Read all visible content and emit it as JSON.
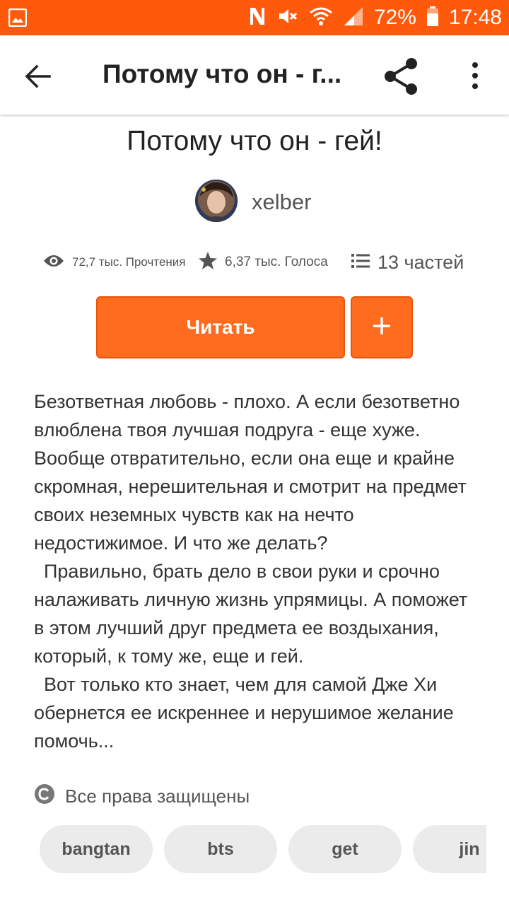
{
  "status_bar": {
    "battery": "72%",
    "time": "17:48",
    "icons": [
      "gallery-icon",
      "n-icon",
      "mute-icon",
      "wifi-icon",
      "signal-icon",
      "battery-icon"
    ]
  },
  "app_bar": {
    "title": "Потому что он - г...",
    "icons": [
      "back-arrow-icon",
      "share-icon",
      "more-vert-icon"
    ]
  },
  "story": {
    "title": "Потому что он - гей!",
    "author": "xelber",
    "stats": {
      "reads": "72,7 тыс. Прочтения",
      "votes": "6,37 тыс. Голоса",
      "parts": "13 частей"
    },
    "read_button_label": "Читать",
    "add_button_label": "+",
    "description": {
      "p1": "Безответная любовь - плохо. А если безответно влюблена твоя лучшая подруга - еще хуже. Вообще отвратительно, если она еще и крайне скромная, нерешительная и смотрит на предмет своих неземных чувств как на нечто недостижимое. И что же делать?",
      "p2": "Правильно, брать дело в свои руки и срочно налаживать личную жизнь упрямицы. А поможет в этом лучший друг предмета ее воздыхания, который, к тому же, еще и гей.",
      "p3": "Вот только кто знает, чем для самой Дже Хи обернется ее искреннее и нерушимое желание помочь..."
    },
    "copyright": "Все права защищены",
    "tags": [
      "bangtan",
      "bts",
      "get",
      "jin"
    ]
  },
  "colors": {
    "accent": "#ff5a0c",
    "button": "#ff6b1f",
    "tag_bg": "#ebebeb"
  }
}
